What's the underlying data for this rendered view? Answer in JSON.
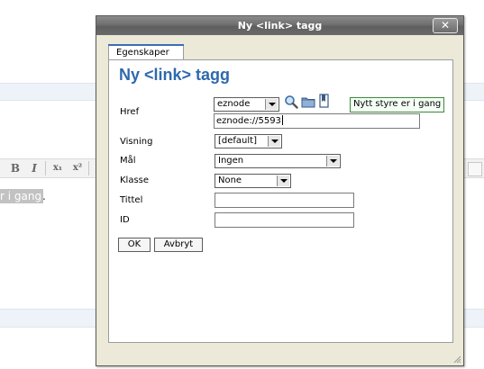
{
  "background": {
    "toolbar": {
      "bold": "B",
      "italic": "I",
      "subscript": "x₁",
      "superscript": "x²"
    },
    "selected_text": "r i gang",
    "trailing_text": "."
  },
  "dialog": {
    "title": "Ny <link> tagg",
    "close_label": "✕",
    "tab_label": "Egenskaper",
    "heading": "Ny <link> tagg",
    "href": {
      "label": "Href",
      "type_value": "eznode",
      "url_value": "eznode://5593",
      "tooltip": "Nytt styre er i gang"
    },
    "visning": {
      "label": "Visning",
      "value": "[default]"
    },
    "maal": {
      "label": "Mål",
      "value": "Ingen"
    },
    "klasse": {
      "label": "Klasse",
      "value": "None"
    },
    "tittel": {
      "label": "Tittel",
      "value": ""
    },
    "id": {
      "label": "ID",
      "value": ""
    },
    "buttons": {
      "ok": "OK",
      "cancel": "Avbryt"
    }
  },
  "colors": {
    "heading": "#2e69ad",
    "tab_accent": "#3a6fb3",
    "tooltip_border": "#3a8a3a",
    "dialog_bg": "#ece9d8"
  }
}
